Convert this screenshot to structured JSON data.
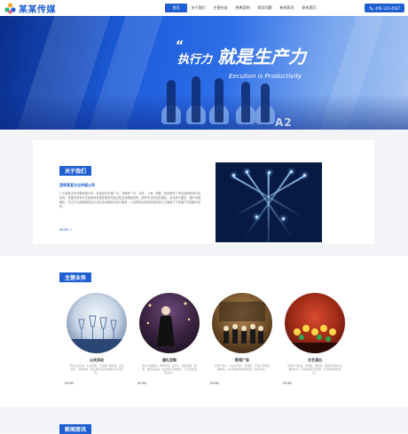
{
  "brand": {
    "name": "某某传媒"
  },
  "nav": {
    "items": [
      {
        "label": "首页",
        "active": true
      },
      {
        "label": "关于我们",
        "active": false
      },
      {
        "label": "主营业务",
        "active": false
      },
      {
        "label": "经典案例",
        "active": false
      },
      {
        "label": "常见问题",
        "active": false
      },
      {
        "label": "新闻资讯",
        "active": false
      },
      {
        "label": "联系我们",
        "active": false
      }
    ],
    "hotline": "400-123-4567"
  },
  "banner": {
    "slogan_part1": "执行力",
    "slogan_part2": "就是生产力",
    "slogan_en": "Eecution is Productivity",
    "screen_text": "A2"
  },
  "about": {
    "tag": "关于我们",
    "company": "昆明某某文化传媒公司",
    "body": "广州某某文化传媒有限公司，总部设在中国广州，并拥有广州、北京、上海、成都、西安等多个事业部和多家分支机构，是国内具有丰富经验和全国性服务的综合性活动策划机构，拥有专业的创意团队、活动执行团队、媒介传播团队，专注于为品牌提供全方位的活动策划与执行服务，以优秀的创意和高效的执行力赢得了众多客户的信赖与合作。",
    "more": "MORE →"
  },
  "services": {
    "tag": "主营业务",
    "items": [
      {
        "title": "公关活动",
        "desc": "专业公关活动、礼仪庆典、产品推广发布会、商务会议、年会晚会、展览展示等活动策划与执行服务。",
        "more": "MORE"
      },
      {
        "title": "婚礼定制",
        "desc": "婚礼全案策划、场地布置、主持人、摄影摄像、婚车、婚庆用品等一站式婚礼定制服务，打造专属浪漫时刻。",
        "more": "MORE"
      },
      {
        "title": "影视广告",
        "desc": "影视广告片、企业宣传片、微电影、产品广告等拍摄制作，从创意策划到后期剪辑一站式完成。",
        "more": "MORE"
      },
      {
        "title": "文艺演出",
        "desc": "各类文艺晚会、演唱会、舞台剧、歌舞表演等演出策划执行，专业舞美灯光音响，打造精彩视听盛宴。",
        "more": "MORE"
      }
    ]
  },
  "news": {
    "tag": "新闻资讯"
  },
  "colors": {
    "primary": "#1f5fd1",
    "section_bg": "#f2f4f8"
  }
}
